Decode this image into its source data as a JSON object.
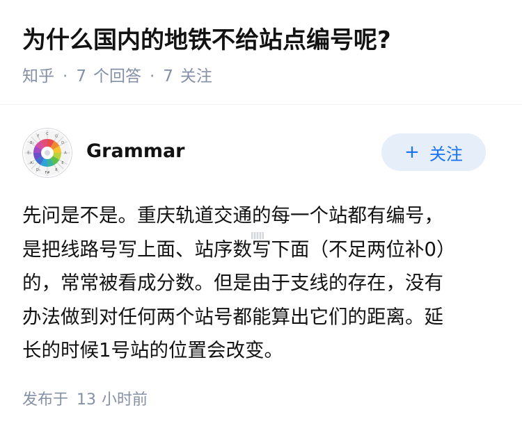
{
  "question": {
    "title": "为什么国内的地铁不给站点编号呢?",
    "source": "知乎",
    "separator": "·",
    "answers_count": "7",
    "answers_label": "个回答",
    "followers_count": "7",
    "followers_label": "关注"
  },
  "answer": {
    "author": {
      "name": "Grammar",
      "avatar_icon": "circle-of-fifths-avatar"
    },
    "follow_button": {
      "plus": "+",
      "label": "关注"
    },
    "body_lines": [
      "先问是不是。重庆轨道交通的每一个站都有编号，",
      "是把线路号写上面、站序数写下面（不足两位补0）",
      "的，常常被看成分数。但是由于支线的存在，没有",
      "办法做到对任何两个站号都能算出它们的距离。延",
      "长的时候1号站的位置会改变。"
    ],
    "published": {
      "prefix": "发布于",
      "amount": "13",
      "unit": "小时前"
    }
  },
  "colors": {
    "accent": "#1772f6",
    "follow_bg": "#e5eef9",
    "meta_gray": "#8590a6",
    "text": "#121212"
  }
}
